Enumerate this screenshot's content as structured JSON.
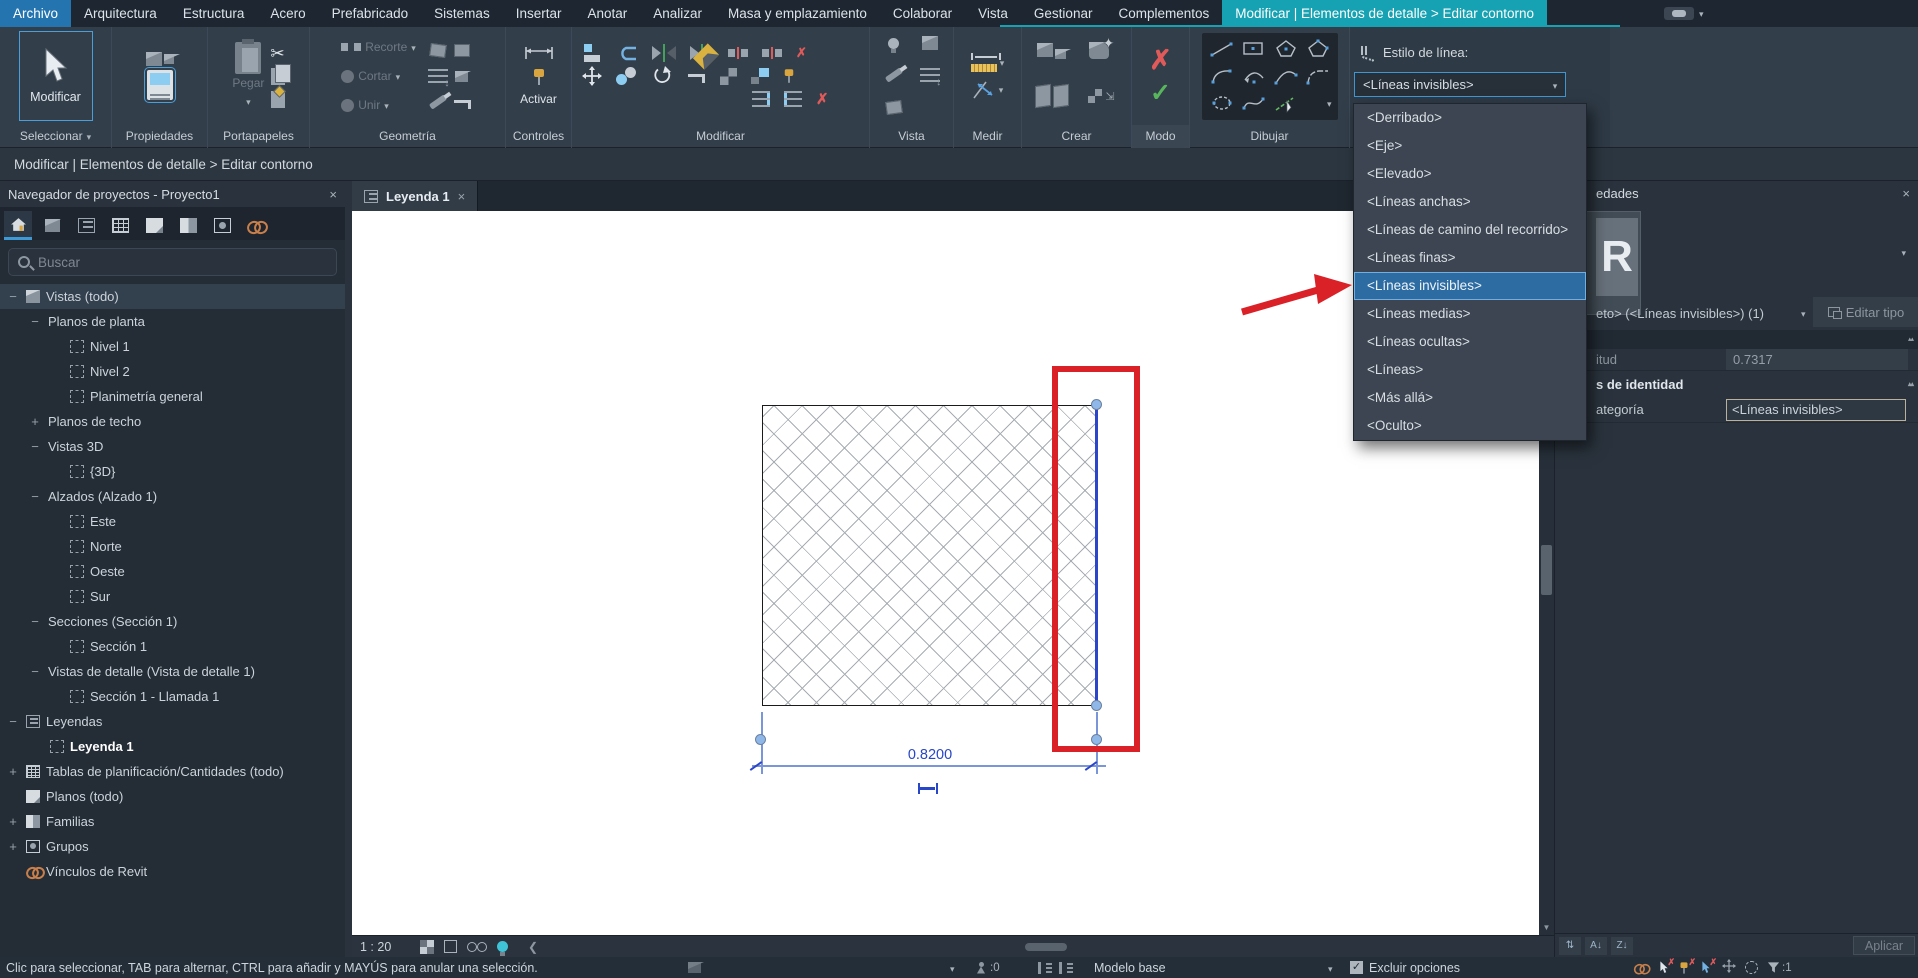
{
  "tabbar": {
    "tabs": [
      {
        "label": "Archivo",
        "cls": "t-file"
      },
      {
        "label": "Arquitectura"
      },
      {
        "label": "Estructura"
      },
      {
        "label": "Acero"
      },
      {
        "label": "Prefabricado"
      },
      {
        "label": "Sistemas"
      },
      {
        "label": "Insertar"
      },
      {
        "label": "Anotar"
      },
      {
        "label": "Analizar"
      },
      {
        "label": "Masa y emplazamiento"
      },
      {
        "label": "Colaborar"
      },
      {
        "label": "Vista"
      },
      {
        "label": "Gestionar"
      },
      {
        "label": "Complementos"
      },
      {
        "label": "Modificar | Elementos de detalle > Editar contorno",
        "cls": "t-ctx"
      }
    ]
  },
  "ribbon": {
    "groups": [
      "Seleccionar",
      "Propiedades",
      "Portapapeles",
      "Geometría",
      "Controles",
      "Modificar",
      "Vista",
      "Medir",
      "Crear",
      "Modo",
      "Dibujar"
    ],
    "modify_button": "Modificar",
    "paste_label": "Pegar",
    "recorte_label": "Recorte",
    "cortar_label": "Cortar",
    "unir_label": "Unir",
    "activate_label": "Activar",
    "line_style_label": "Estilo de línea:",
    "line_style_value": "<Líneas invisibles>"
  },
  "line_style_dropdown": {
    "items": [
      {
        "label": "<Derribado>"
      },
      {
        "label": "<Eje>"
      },
      {
        "label": "<Elevado>"
      },
      {
        "label": "<Líneas anchas>"
      },
      {
        "label": "<Líneas de camino del recorrido>"
      },
      {
        "label": "<Líneas finas>"
      },
      {
        "label": "<Líneas invisibles>",
        "cls": "dd-selected"
      },
      {
        "label": "<Líneas medias>"
      },
      {
        "label": "<Líneas ocultas>"
      },
      {
        "label": "<Líneas>"
      },
      {
        "label": "<Más allá>"
      },
      {
        "label": "<Oculto>"
      }
    ]
  },
  "breadcrumb": {
    "text": "Modificar | Elementos de detalle > Editar contorno"
  },
  "navigator": {
    "title": "Navegador de proyectos - Proyecto1",
    "search_placeholder": "Buscar",
    "toolbar_icons": [
      "home-icon",
      "views-3d-icon",
      "legend-icon",
      "schedule-icon",
      "sheet-icon",
      "family-icon",
      "group-icon",
      "link-icon"
    ],
    "tree": [
      {
        "exp": "−",
        "icon": "i-viewcube",
        "label": "Vistas (todo)",
        "cls": "lvl0 sel"
      },
      {
        "exp": "−",
        "icon": "i-none",
        "label": "Planos de planta",
        "cls": "lvl1"
      },
      {
        "exp": "",
        "icon": "i-view",
        "label": "Nivel 1",
        "cls": "lvl2"
      },
      {
        "exp": "",
        "icon": "i-view",
        "label": "Nivel 2",
        "cls": "lvl2"
      },
      {
        "exp": "",
        "icon": "i-view",
        "label": "Planimetría general",
        "cls": "lvl2"
      },
      {
        "exp": "+",
        "icon": "i-none",
        "label": "Planos de techo",
        "cls": "lvl1"
      },
      {
        "exp": "−",
        "icon": "i-none",
        "label": "Vistas 3D",
        "cls": "lvl1"
      },
      {
        "exp": "",
        "icon": "i-view",
        "label": "{3D}",
        "cls": "lvl2"
      },
      {
        "exp": "−",
        "icon": "i-none",
        "label": "Alzados (Alzado 1)",
        "cls": "lvl1"
      },
      {
        "exp": "",
        "icon": "i-view",
        "label": "Este",
        "cls": "lvl2"
      },
      {
        "exp": "",
        "icon": "i-view",
        "label": "Norte",
        "cls": "lvl2"
      },
      {
        "exp": "",
        "icon": "i-view",
        "label": "Oeste",
        "cls": "lvl2"
      },
      {
        "exp": "",
        "icon": "i-view",
        "label": "Sur",
        "cls": "lvl2"
      },
      {
        "exp": "−",
        "icon": "i-none",
        "label": "Secciones (Sección 1)",
        "cls": "lvl1"
      },
      {
        "exp": "",
        "icon": "i-view",
        "label": "Sección 1",
        "cls": "lvl2"
      },
      {
        "exp": "−",
        "icon": "i-none",
        "label": "Vistas de detalle (Vista de detalle 1)",
        "cls": "lvl1"
      },
      {
        "exp": "",
        "icon": "i-view",
        "label": "Sección 1 - Llamada 1",
        "cls": "lvl2"
      },
      {
        "exp": "−",
        "icon": "i-legend",
        "label": "Leyendas",
        "cls": "lvl0"
      },
      {
        "exp": "",
        "icon": "i-view",
        "label": "Leyenda 1",
        "cls": "lvl1v bold"
      },
      {
        "exp": "+",
        "icon": "i-table",
        "label": "Tablas de planificación/Cantidades (todo)",
        "cls": "lvl0"
      },
      {
        "exp": "",
        "icon": "i-sheet",
        "label": "Planos (todo)",
        "cls": "lvl0"
      },
      {
        "exp": "+",
        "icon": "i-family",
        "label": "Familias",
        "cls": "lvl0"
      },
      {
        "exp": "+",
        "icon": "i-group",
        "label": "Grupos",
        "cls": "lvl0"
      },
      {
        "exp": "",
        "icon": "i-link",
        "label": "Vínculos de Revit",
        "cls": "lvl0"
      }
    ]
  },
  "document_tabs": {
    "active_label": "Leyenda 1"
  },
  "drawing": {
    "dimension_value": "0.8200"
  },
  "properties_panel": {
    "title_visible": "edades",
    "preview_letter": "R",
    "type_selector_visible": "eto> (<Líneas invisibles>) (1)",
    "edit_type_label": "Editar tipo",
    "length_label_visible": "itud",
    "length_value": "0.7317",
    "identity_header_visible": "s de identidad",
    "subcategory_label_visible": "ategoría",
    "subcategory_value": "<Líneas invisibles>",
    "apply_label": "Aplicar"
  },
  "view_controls": {
    "scale": "1 : 20"
  },
  "statusbar": {
    "hint": "Clic para seleccionar, TAB para alternar, CTRL para añadir y MAYÚS para anular una selección.",
    "requests_count": ":0",
    "design_option": "Modelo base",
    "exclude_options": "Excluir opciones",
    "selection_count": ":1"
  },
  "colors": {
    "accent_teal": "#16a2b2",
    "file_tab_blue": "#2474af",
    "selection_blue": "#2d6ca3",
    "annotation_red": "#d92127",
    "dimension_blue": "#2b46c8"
  }
}
